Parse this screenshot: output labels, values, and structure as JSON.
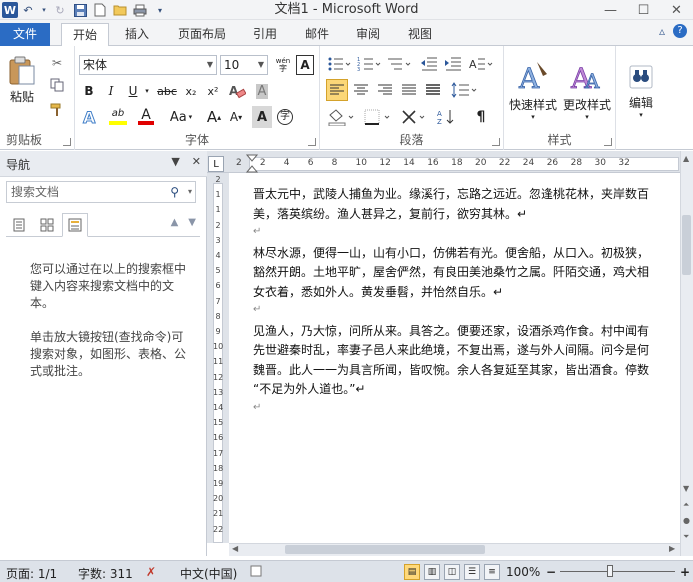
{
  "window": {
    "title": "文档1 - Microsoft Word",
    "app_icon": "word-logo",
    "logo_letter": "W"
  },
  "ribbon_tabs": [
    {
      "label": "文件"
    },
    {
      "label": "开始"
    },
    {
      "label": "插入"
    },
    {
      "label": "页面布局"
    },
    {
      "label": "引用"
    },
    {
      "label": "邮件"
    },
    {
      "label": "审阅"
    },
    {
      "label": "视图"
    }
  ],
  "clipboard": {
    "paste_label": "粘贴",
    "group_label": "剪贴板"
  },
  "font": {
    "name": "宋体",
    "size": "10",
    "group_label": "字体",
    "bold": "B",
    "italic": "I",
    "underline": "U",
    "strike": "abc",
    "subscript": "x₂",
    "superscript": "x²",
    "case": "Aa",
    "grow": "A",
    "shrink": "A",
    "highlight": "ab",
    "font_color": "A",
    "char_border": "A",
    "char_shade": "A",
    "phonetic": "wén",
    "enclose": "字"
  },
  "paragraph": {
    "group_label": "段落"
  },
  "styles": {
    "group_label": "样式",
    "quick_styles": "快速样式",
    "change_styles": "更改样式"
  },
  "editing": {
    "label": "编辑"
  },
  "nav_pane": {
    "title": "导航",
    "search_placeholder": "搜索文档",
    "hint1": "您可以通过在以上的搜索框中键入内容来搜索文档中的文本。",
    "hint2": "单击放大镜按钮(查找命令)可搜索对象，如图形、表格、公式或批注。"
  },
  "ruler": {
    "tab_selector": "L",
    "numbers": [
      "2",
      "2",
      "4",
      "6",
      "8",
      "10",
      "12",
      "14",
      "16",
      "18",
      "20",
      "22",
      "24",
      "26",
      "28",
      "30",
      "32"
    ],
    "v_numbers": [
      "2",
      "1",
      "1",
      "2",
      "3",
      "4",
      "5",
      "6",
      "7",
      "8",
      "9",
      "10",
      "11",
      "12",
      "13",
      "14",
      "15",
      "16",
      "17",
      "18",
      "19",
      "20",
      "21",
      "22"
    ]
  },
  "document": {
    "paragraphs": [
      [
        "晋太元中，武陵人捕鱼为业。缘溪行，忘路之远近。忽逢桃花林，夹岸数百",
        "美，落英缤纷。渔人甚异之，复前行，欲穷其林。↵"
      ],
      [
        "林尽水源，便得一山，山有小口，仿佛若有光。便舍船，从口入。初极狭，",
        "豁然开朗。土地平旷，屋舍俨然，有良田美池桑竹之属。阡陌交通，鸡犬相",
        "女衣着，悉如外人。黄发垂髫，并怡然自乐。↵"
      ],
      [
        "见渔人，乃大惊，问所从来。具答之。便要还家，设酒杀鸡作食。村中闻有",
        "先世避秦时乱，率妻子邑人来此绝境，不复出焉，遂与外人间隔。问今是何",
        "魏晋。此人一一为具言所闻，皆叹惋。余人各复延至其家，皆出酒食。停数",
        "“不足为外人道也。”↵"
      ]
    ],
    "empty_mark": "↵"
  },
  "status": {
    "page": "页面: 1/1",
    "words": "字数: 311",
    "lang": "中文(中国)",
    "zoom": "100%"
  }
}
